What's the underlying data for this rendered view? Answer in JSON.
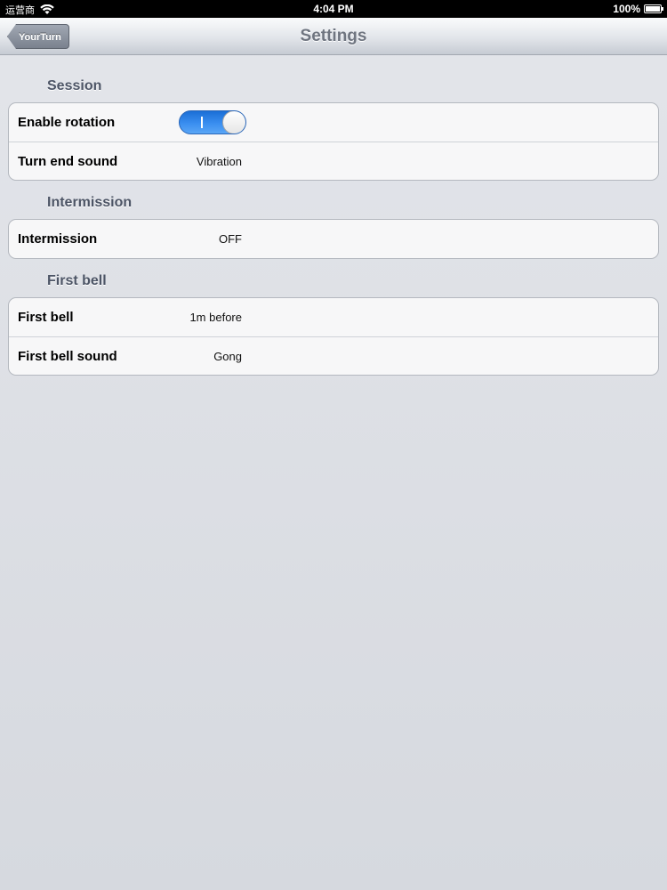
{
  "status_bar": {
    "carrier": "运营商",
    "time": "4:04 PM",
    "battery": "100%"
  },
  "nav": {
    "back_label": "YourTurn",
    "title": "Settings"
  },
  "sections": [
    {
      "header": "Session",
      "rows": [
        {
          "label": "Enable rotation",
          "type": "toggle",
          "value": true
        },
        {
          "label": "Turn end sound",
          "value": "Vibration"
        }
      ]
    },
    {
      "header": "Intermission",
      "rows": [
        {
          "label": "Intermission",
          "value": "OFF"
        }
      ]
    },
    {
      "header": "First bell",
      "rows": [
        {
          "label": "First bell",
          "value": "1m before"
        },
        {
          "label": "First bell sound",
          "value": "Gong"
        }
      ]
    }
  ],
  "colors": {
    "toggle_on": "#2a82e8",
    "section_header": "#4d5566"
  }
}
